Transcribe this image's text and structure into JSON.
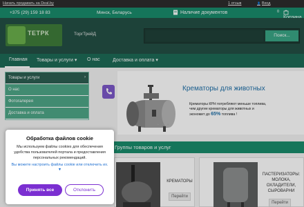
{
  "topbar": {
    "deal_link": "Начать продавать на Deal.by",
    "reviews": "1 отзыв",
    "login": "Вход"
  },
  "contacts": {
    "phone": "+375 (29) 159 18 83",
    "city": "Минск, Беларусь",
    "docs": "Наличие документов",
    "cart": "Корзина",
    "cart_count": "0"
  },
  "header": {
    "logo_text": "ТЕТРК",
    "brand": "ТоргТрейД",
    "search_button": "Поиск...",
    "search_placeholder": ""
  },
  "nav": {
    "items": [
      "Главная",
      "Товары и услуги",
      "О нас",
      "Доставка и оплата"
    ],
    "more": "▾"
  },
  "sidebar": {
    "items": [
      "Товары и услуги",
      "О нас",
      "Фотогалерея",
      "Доставка и оплата"
    ]
  },
  "banner": {
    "title": "Крематоры для животных",
    "desc_1": "Крематоры КРН потребляют меньше топлива,",
    "desc_2": "чем другие крематоры для животных и",
    "desc_3": "экономит  до",
    "percent": "65%",
    "desc_4": "топлива !"
  },
  "section": {
    "title": "Группы товаров и услуг"
  },
  "products": [
    {
      "name": "КРЕМАТОРЫ",
      "button": "Перейти"
    },
    {
      "name": "ПАСТЕРИЗАТОРЫ: МОЛОКА, ОХЛАДИТЕЛИ, СЫРОВАРНИ",
      "button": "Перейти"
    }
  ],
  "cookie": {
    "title": "Обработка файлов cookie",
    "text": "Мы используем файлы cookies для обеспечения удобства пользователей портала и предоставления персональных рекомендаций.",
    "settings_link": "Вы можете настроить файлы cookie или отключить их. ▼",
    "accept": "Принять все",
    "decline": "Отклонить"
  },
  "colors": {
    "primary": "#1a8c6c",
    "header": "#234f44",
    "accent": "#7b2fd1",
    "link": "#1e6fd0"
  }
}
